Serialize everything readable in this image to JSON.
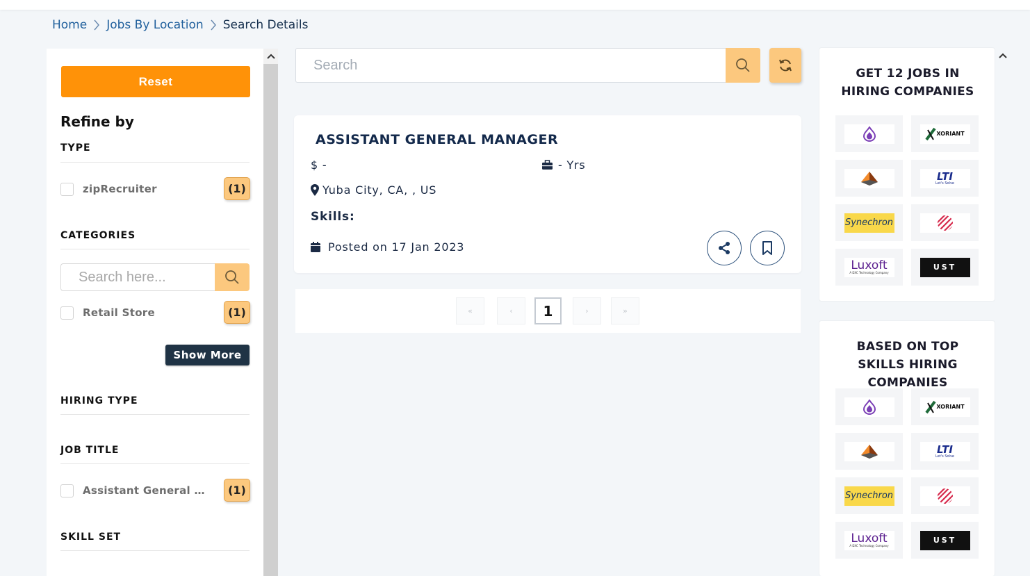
{
  "breadcrumb": {
    "home": "Home",
    "jobs_by_location": "Jobs By Location",
    "current": "Search Details"
  },
  "sidebar": {
    "reset_label": "Reset",
    "refine_by": "Refine by",
    "type": {
      "heading": "TYPE",
      "items": [
        {
          "label": "zipRecruiter",
          "count": "(1)"
        }
      ]
    },
    "categories": {
      "heading": "CATEGORIES",
      "search_placeholder": "Search here...",
      "items": [
        {
          "label": "Retail Store",
          "count": "(1)"
        }
      ],
      "show_more_label": "Show More"
    },
    "hiring_type": {
      "heading": "HIRING TYPE"
    },
    "job_title": {
      "heading": "JOB TITLE",
      "items": [
        {
          "label": "Assistant General Manager",
          "count": "(1)"
        }
      ]
    },
    "skill_set": {
      "heading": "SKILL SET"
    }
  },
  "main": {
    "search_placeholder": "Search",
    "job": {
      "title": "ASSISTANT GENERAL MANAGER",
      "salary": "$ -",
      "experience": "- Yrs",
      "location": "Yuba City, CA, , US",
      "skills_label": "Skills:",
      "posted": "Posted on 17 Jan 2023"
    },
    "pagination": {
      "first": "«",
      "prev": "‹",
      "current": "1",
      "next": "›",
      "last": "»"
    }
  },
  "right": {
    "panel1_title": "GET 12 JOBS IN HIRING COMPANIES",
    "panel2_title": "BASED ON TOP SKILLS HIRING COMPANIES",
    "logos": [
      "Synechron",
      "Luxoft",
      "LTI",
      "Let's Solve",
      "XORIANT",
      "UST",
      "A DXC Technology Company"
    ]
  },
  "colors": {
    "accent_orange": "#ff9208",
    "badge_orange": "#fcc87e",
    "navy": "#13294b",
    "link_blue": "#1f5f9c"
  }
}
